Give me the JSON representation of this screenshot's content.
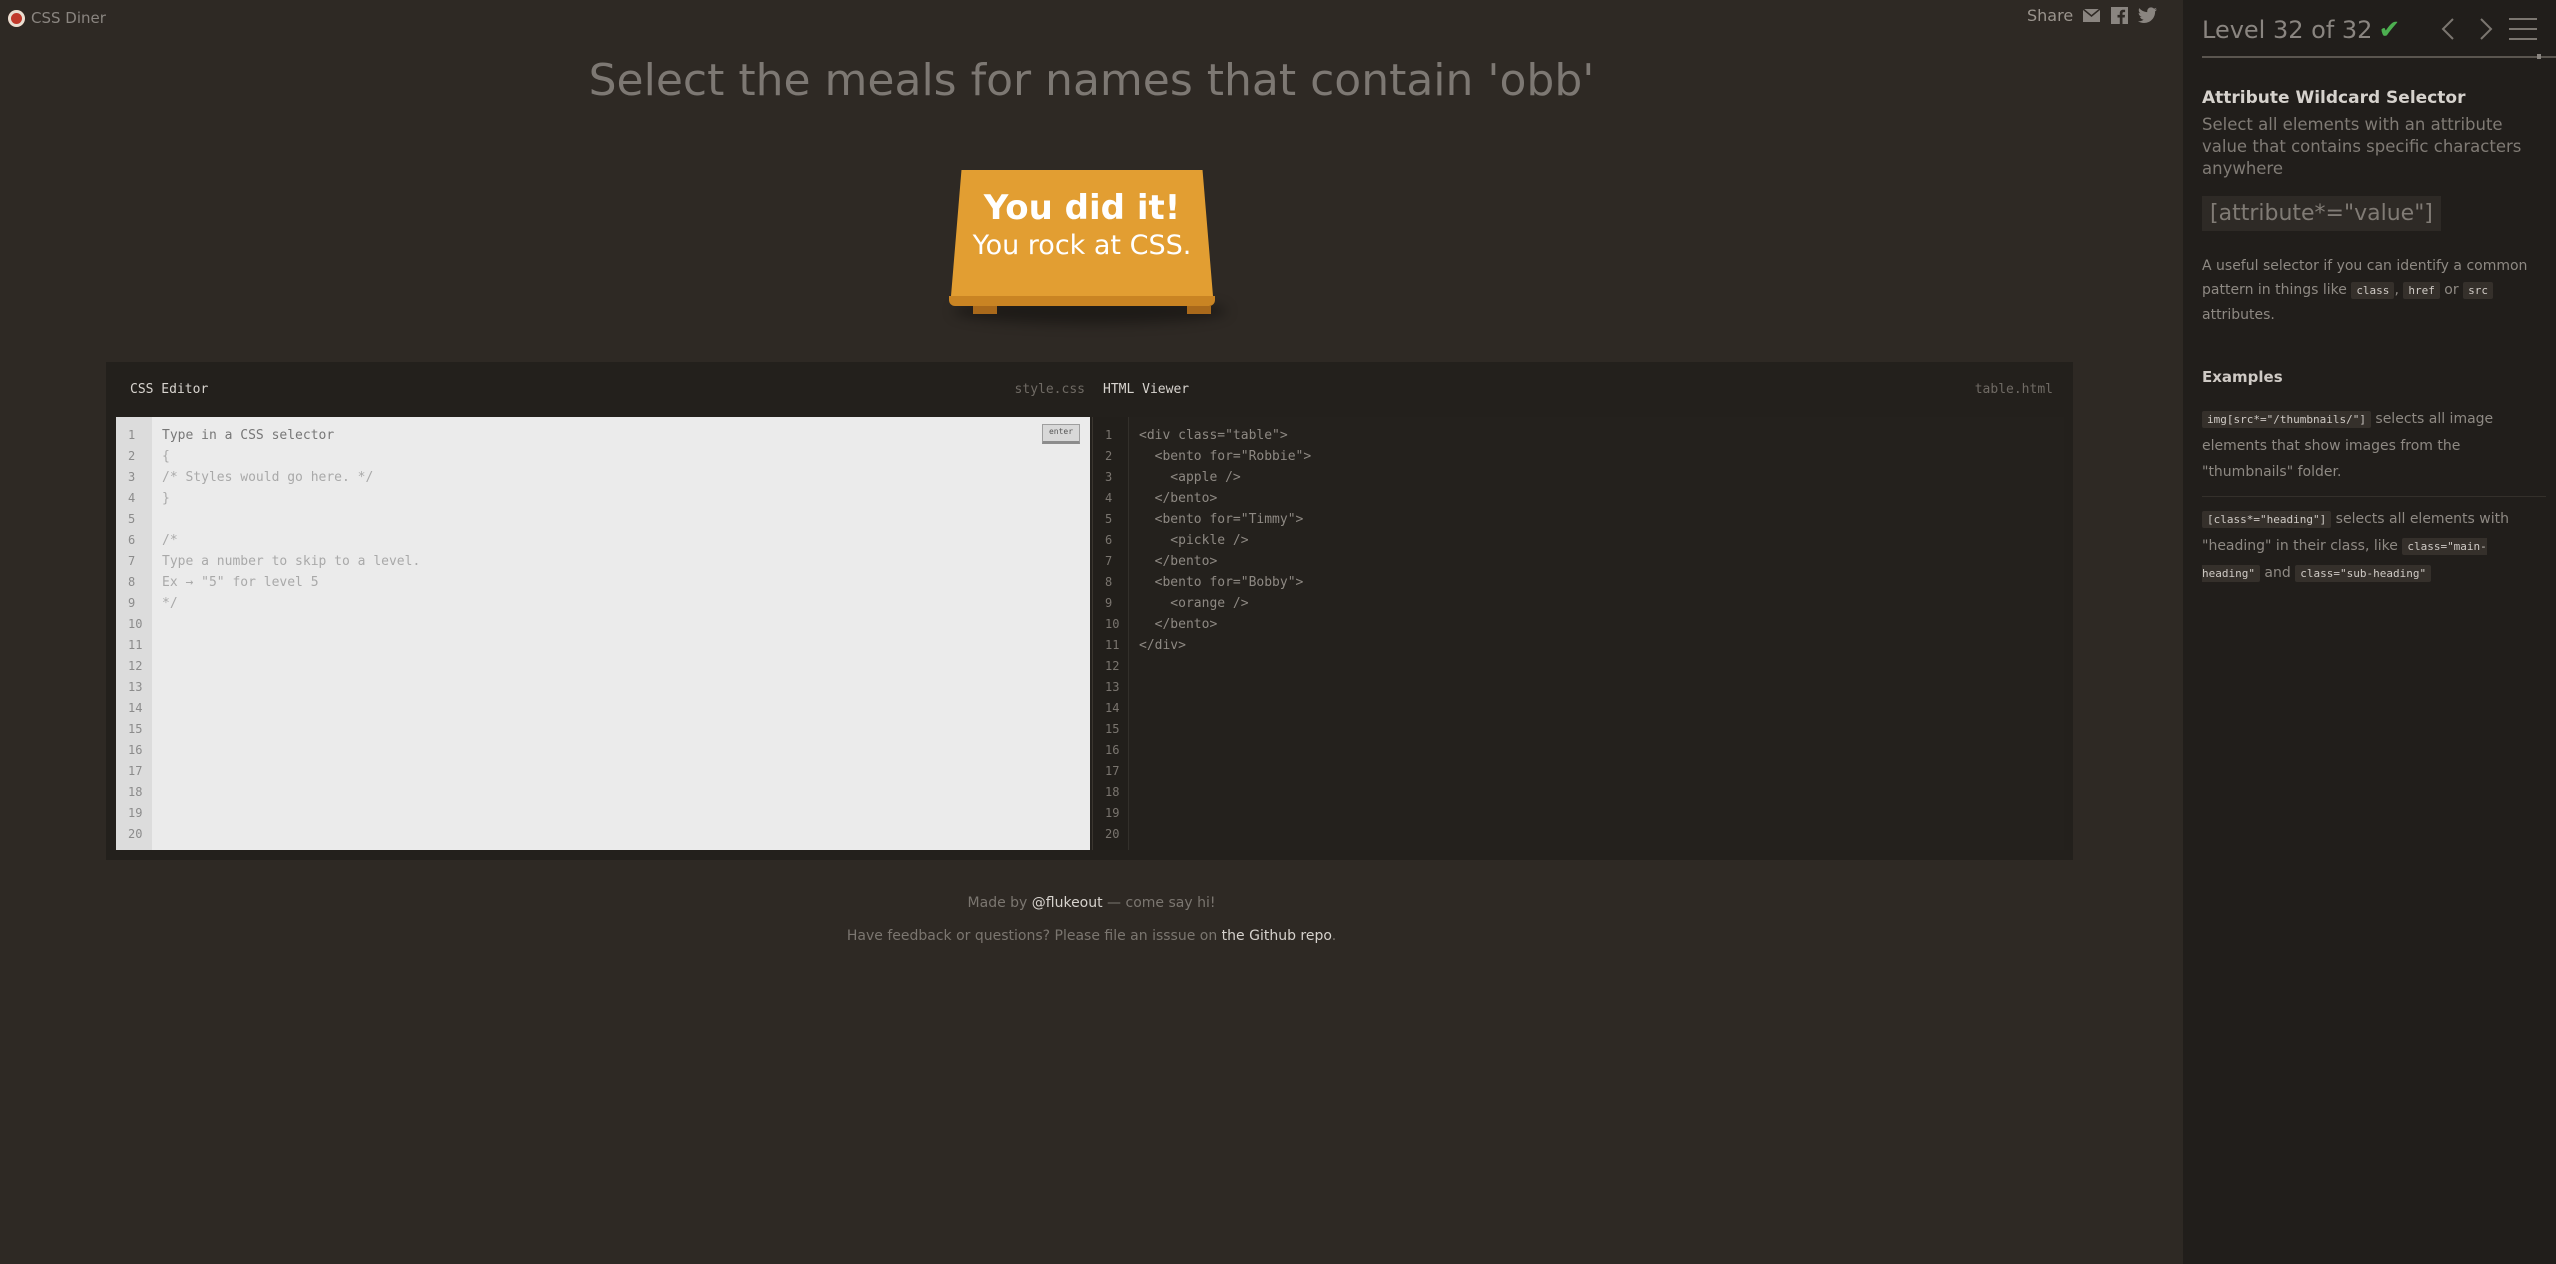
{
  "brand": {
    "name": "CSS Diner"
  },
  "share": {
    "label": "Share",
    "icons": [
      "mail-icon",
      "facebook-icon",
      "twitter-icon"
    ]
  },
  "instruction": "Select the meals for names that contain 'obb'",
  "plate": {
    "line1": "You did it!",
    "line2": "You rock at CSS."
  },
  "css_editor": {
    "title": "CSS Editor",
    "file": "style.css",
    "enter_label": "enter",
    "line_numbers": [
      "1",
      "2",
      "3",
      "4",
      "5",
      "6",
      "7",
      "8",
      "9",
      "10",
      "11",
      "12",
      "13",
      "14",
      "15",
      "16",
      "17",
      "18",
      "19",
      "20"
    ],
    "lines": [
      "Type in a CSS selector",
      "{",
      "/* Styles would go here. */",
      "}",
      "",
      "/*",
      "Type a number to skip to a level.",
      "Ex → \"5\" for level 5",
      "*/"
    ]
  },
  "html_viewer": {
    "title": "HTML Viewer",
    "file": "table.html",
    "line_numbers": [
      "1",
      "2",
      "3",
      "4",
      "5",
      "6",
      "7",
      "8",
      "9",
      "10",
      "11",
      "12",
      "13",
      "14",
      "15",
      "16",
      "17",
      "18",
      "19",
      "20"
    ],
    "lines": [
      "<div class=\"table\">",
      "  <bento for=\"Robbie\">",
      "    <apple />",
      "  </bento>",
      "  <bento for=\"Timmy\">",
      "    <pickle />",
      "  </bento>",
      "  <bento for=\"Bobby\">",
      "    <orange />",
      "  </bento>",
      "</div>"
    ]
  },
  "footer": {
    "made_by_prefix": "Made by ",
    "made_by_link": "@flukeout",
    "made_by_suffix": " — come say hi!",
    "feedback_prefix": "Have feedback or questions? Please file an isssue on ",
    "feedback_link": "the Github repo",
    "feedback_suffix": "."
  },
  "sidebar": {
    "level_label": "Level 32 of 32",
    "completed": "✔",
    "selector_name": "Attribute Wildcard Selector",
    "selector_title": "Select all elements with an attribute value that contains specific characters anywhere",
    "syntax": "[attribute*=\"value\"]",
    "hint_prefix": "A useful selector if you can identify a common pattern in things like ",
    "hint_code1": "class",
    "hint_sep1": ", ",
    "hint_code2": "href",
    "hint_sep2": " or ",
    "hint_code3": "src",
    "hint_suffix": " attributes.",
    "examples_heading": "Examples",
    "example1_code": "img[src*=\"/thumbnails/\"]",
    "example1_text": " selects all image elements that show images from the \"thumbnails\" folder.",
    "example2_code": "[class*=\"heading\"]",
    "example2_text": " selects all elements with \"heading\" in their class, like ",
    "example2_code2": "class=\"main-heading\"",
    "example2_and": " and ",
    "example2_code3": "class=\"sub-heading\""
  },
  "colors": {
    "accent_orange": "#e29e32",
    "check_green": "#4caf50",
    "background": "#2e2924",
    "sidebar_bg": "#211e1b"
  }
}
